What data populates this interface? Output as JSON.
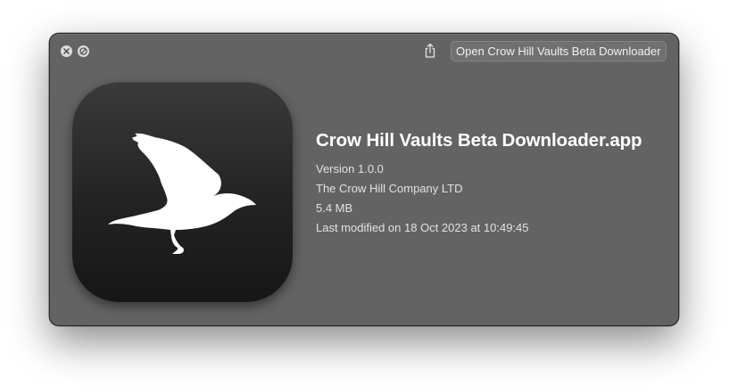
{
  "window": {
    "controls": {
      "close_icon": "close-icon",
      "fullscreen_icon": "fullscreen-disabled-icon"
    },
    "toolbar": {
      "share_icon": "share-icon",
      "open_button_label": "Open Crow Hill Vaults Beta Downloader"
    }
  },
  "file": {
    "icon": "crow-app-icon",
    "name": "Crow Hill Vaults Beta Downloader.app",
    "version": "Version 1.0.0",
    "company": "The Crow Hill Company LTD",
    "size": "5.4 MB",
    "modified": "Last modified on 18 Oct 2023 at 10:49:45"
  },
  "colors": {
    "window_bg": "#636363",
    "icon_bg_top": "#3a3a3a",
    "icon_bg_bottom": "#161616",
    "title_text": "#ffffff",
    "meta_text": "#e2e2e2"
  }
}
